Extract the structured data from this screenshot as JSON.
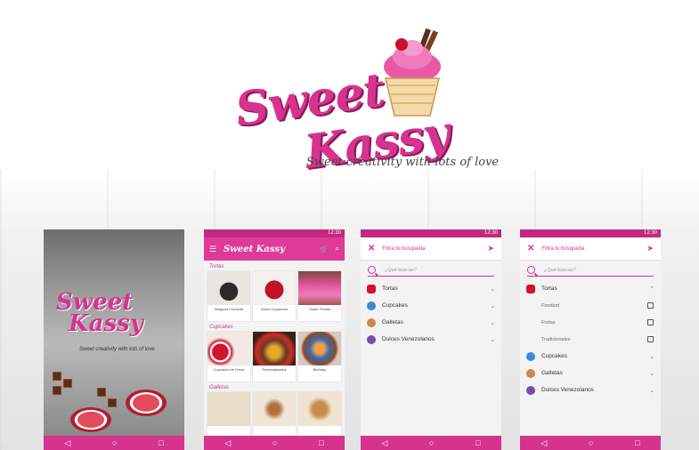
{
  "brand": {
    "name_line1": "Sweet",
    "name_line2": "Kassy",
    "tagline": "Sweet creativity with lots of love",
    "color_primary": "#d6338f",
    "color_dark": "#c2287e"
  },
  "status": {
    "time": "12:30"
  },
  "catalog": {
    "app_logo": "Sweet Kassy",
    "sections": [
      {
        "title": "Tortas",
        "items": [
          "Ninguna Crocante",
          "Dulce Ocupación",
          "Super Fresita"
        ]
      },
      {
        "title": "Cupcakes",
        "items": [
          "Cupcakes de Fresa",
          "Personalizados",
          "Birthday"
        ]
      },
      {
        "title": "Galletas",
        "items": []
      }
    ]
  },
  "filter": {
    "title": "Filtra tu búsqueda",
    "search_placeholder": "¿Qué buscas?",
    "categories": [
      "Tortas",
      "Cupcakes",
      "Galletas",
      "Dulces Venezolanos"
    ],
    "tortas_sub": [
      "Fondant",
      "Frutas",
      "Tradicionales"
    ]
  },
  "icons": {
    "close": "close-icon",
    "send": "send-icon",
    "menu": "menu-icon",
    "cart": "cart-icon",
    "search": "search-icon",
    "nav": [
      "back-icon",
      "home-icon",
      "recent-icon"
    ]
  }
}
